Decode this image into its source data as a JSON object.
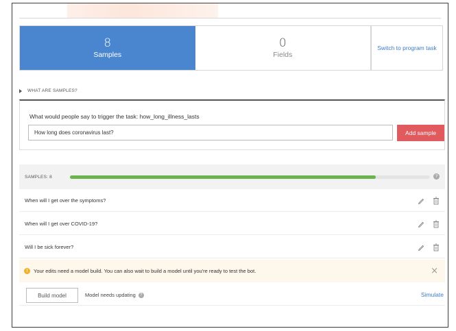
{
  "tabs": [
    {
      "count": "8",
      "label": "Samples"
    },
    {
      "count": "0",
      "label": "Fields"
    }
  ],
  "switch_label": "Switch to program task",
  "what_are_samples": "WHAT ARE SAMPLES?",
  "trigger": {
    "question": "What would people say to trigger the task: how_long_illness_lasts",
    "input_value": "How long does coronavirus last?",
    "add_label": "Add sample"
  },
  "samples": {
    "count_label": "SAMPLES: 8",
    "progress": 0.85,
    "help": "?",
    "items": [
      "When will I get over the symptoms?",
      "When will I get over COVID-19?",
      "Will I be sick forever?"
    ]
  },
  "notice": {
    "icon": "!",
    "text": "Your edits need a model build. You can also wait to build a model until you're ready to test the bot.",
    "close": "×"
  },
  "footer": {
    "build_label": "Build model",
    "status_text": "Model needs updating",
    "status_help": "?",
    "simulate_label": "Simulate"
  },
  "colors": {
    "accent_blue": "#4a86d0",
    "add_red": "#e05a5e",
    "progress_green": "#6ab34d",
    "notice_yellow": "#f1b12a"
  }
}
